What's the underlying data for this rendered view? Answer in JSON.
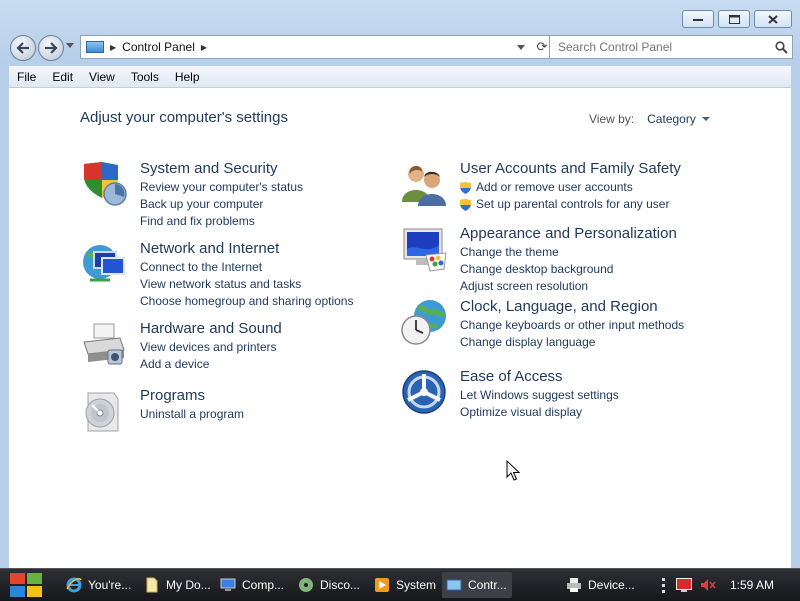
{
  "navigation": {
    "breadcrumb": [
      "Control Panel"
    ],
    "search_placeholder": "Search Control Panel"
  },
  "menu": [
    "File",
    "Edit",
    "View",
    "Tools",
    "Help"
  ],
  "content": {
    "heading": "Adjust your computer's settings",
    "view_by_label": "View by:",
    "view_by_value": "Category",
    "categories": [
      {
        "title": "System and Security",
        "links": [
          "Review your computer's status",
          "Back up your computer",
          "Find and fix problems"
        ]
      },
      {
        "title": "Network and Internet",
        "links": [
          "Connect to the Internet",
          "View network status and tasks",
          "Choose homegroup and sharing options"
        ]
      },
      {
        "title": "Hardware and Sound",
        "links": [
          "View devices and printers",
          "Add a device"
        ]
      },
      {
        "title": "Programs",
        "links": [
          "Uninstall a program"
        ]
      },
      {
        "title": "User Accounts and Family Safety",
        "links": [
          "Add or remove user accounts",
          "Set up parental controls for any user"
        ]
      },
      {
        "title": "Appearance and Personalization",
        "links": [
          "Change the theme",
          "Change desktop background",
          "Adjust screen resolution"
        ]
      },
      {
        "title": "Clock, Language, and Region",
        "links": [
          "Change keyboards or other input methods",
          "Change display language"
        ]
      },
      {
        "title": "Ease of Access",
        "links": [
          "Let Windows suggest settings",
          "Optimize visual display"
        ]
      }
    ]
  },
  "taskbar": {
    "items": [
      "You're...",
      "My Do...",
      "Comp...",
      "Disco...",
      "System",
      "Contr...",
      "Device..."
    ],
    "active_item": "Contr...",
    "clock": "1:59 AM"
  },
  "colors": {
    "link": "#1e395b",
    "window_frame": "#b7cfe8",
    "taskbar": "#1f2024"
  }
}
